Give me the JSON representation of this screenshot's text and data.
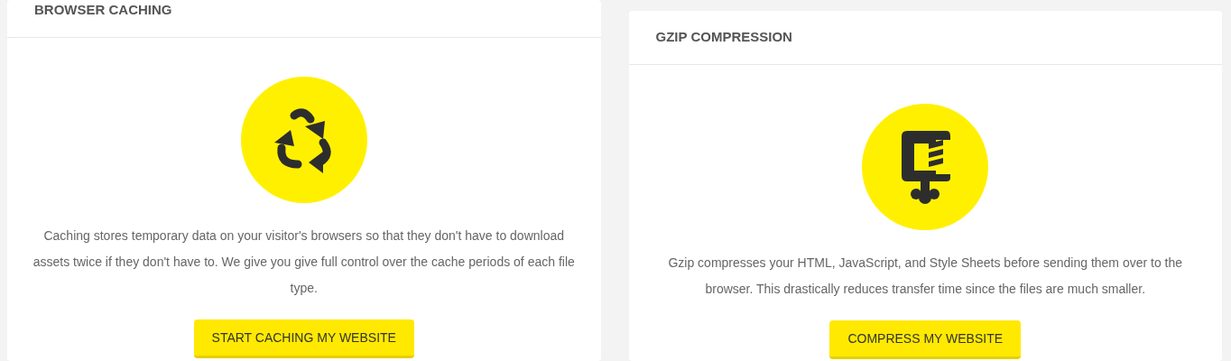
{
  "cards": [
    {
      "kind": "recycle",
      "title": "BROWSER CACHING",
      "description": "Caching stores temporary data on your visitor's browsers so that they don't have to download assets twice if they don't have to. We give you give full control over the cache periods of each file type.",
      "button": "START CACHING MY WEBSITE"
    },
    {
      "kind": "clamp",
      "title": "GZIP COMPRESSION",
      "description": "Gzip compresses your HTML, JavaScript, and Style Sheets before sending them over to the browser. This drastically reduces transfer time since the files are much smaller.",
      "button": "COMPRESS MY WEBSITE"
    }
  ]
}
